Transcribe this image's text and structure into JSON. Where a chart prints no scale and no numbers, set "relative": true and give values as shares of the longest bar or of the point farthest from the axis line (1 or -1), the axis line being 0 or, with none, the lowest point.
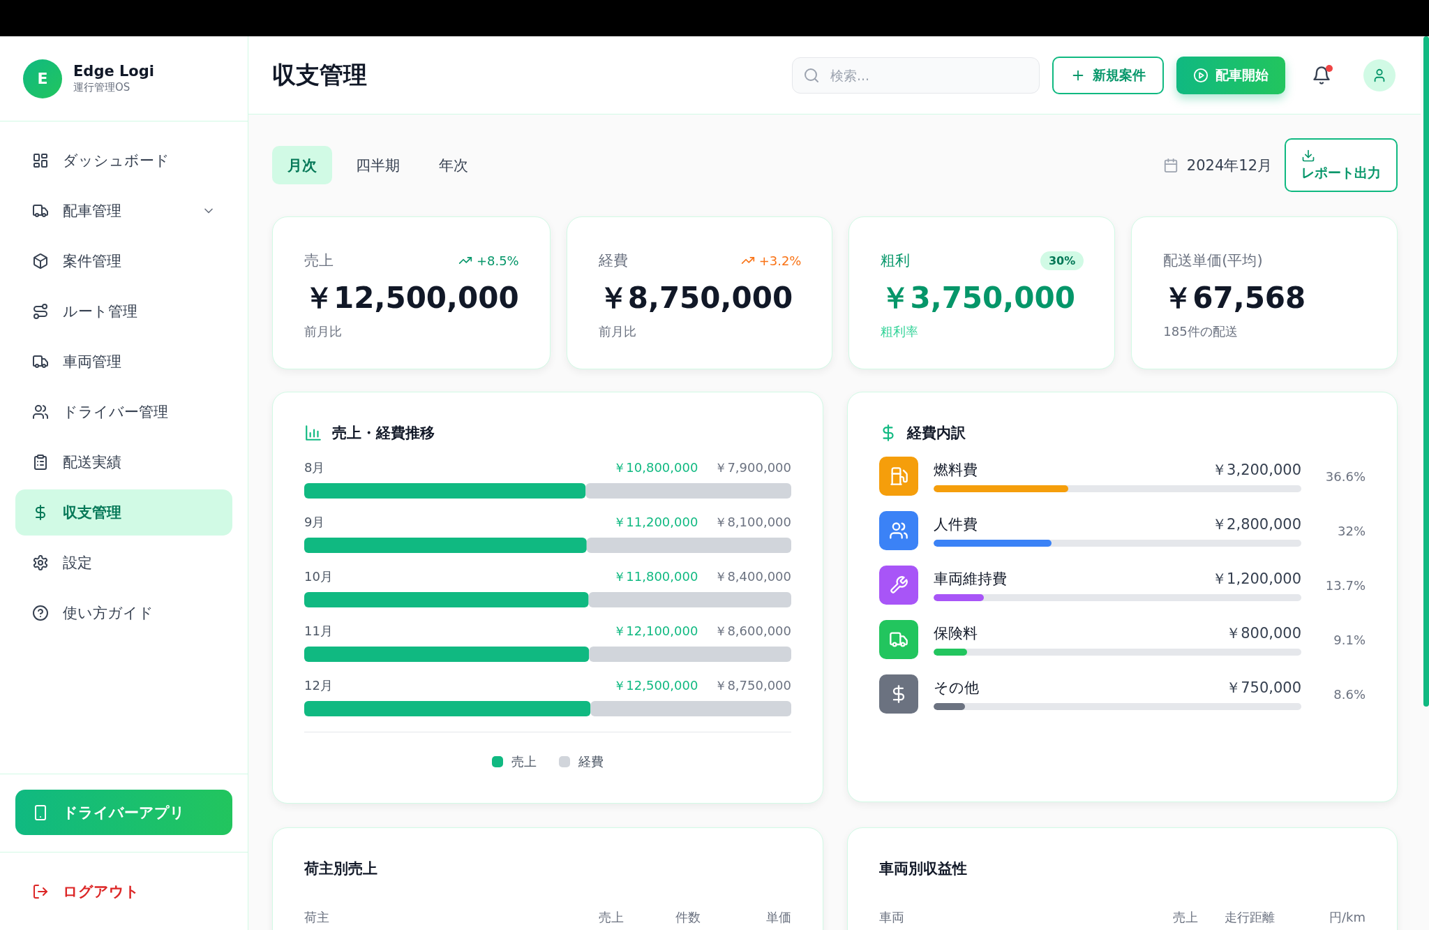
{
  "brand": {
    "logo_letter": "E",
    "name": "Edge Logi",
    "tagline": "運行管理OS"
  },
  "sidebar": {
    "items": [
      {
        "label": "ダッシュボード",
        "selected": false
      },
      {
        "label": "配車管理",
        "selected": false,
        "expanded": false
      },
      {
        "label": "案件管理",
        "selected": false
      },
      {
        "label": "ルート管理",
        "selected": false
      },
      {
        "label": "車両管理",
        "selected": false
      },
      {
        "label": "ドライバー管理",
        "selected": false
      },
      {
        "label": "配送実績",
        "selected": false
      },
      {
        "label": "収支管理",
        "selected": true
      },
      {
        "label": "設定",
        "selected": false
      },
      {
        "label": "使い方ガイド",
        "selected": false
      }
    ],
    "app_button": "ドライバーアプリ",
    "logout": "ログアウト"
  },
  "header": {
    "title": "収支管理",
    "search": {
      "placeholder": "検索..."
    },
    "buttons": [
      {
        "label": "新規案件",
        "kind": "outline"
      },
      {
        "label": "配車開始",
        "kind": "primary"
      }
    ],
    "notifications": {
      "unread": true
    }
  },
  "period_tabs": [
    {
      "label": "月次",
      "selected": true
    },
    {
      "label": "四半期",
      "selected": false
    },
    {
      "label": "年次",
      "selected": false
    }
  ],
  "period": "2024年12月",
  "report_button": "レポート出力",
  "kpis": [
    {
      "label": "売上",
      "value": "￥12,500,000",
      "note": "前月比",
      "badge": {
        "kind": "trend",
        "text": "+8.5%",
        "color": "#059669"
      },
      "accent": false
    },
    {
      "label": "経費",
      "value": "￥8,750,000",
      "note": "前月比",
      "badge": {
        "kind": "trend",
        "text": "+3.2%",
        "color": "#f97316"
      },
      "accent": false
    },
    {
      "label": "粗利",
      "value": "￥3,750,000",
      "note": "粗利率",
      "badge": {
        "kind": "pill",
        "text": "30%",
        "color": "#047857"
      },
      "accent": true
    },
    {
      "label": "配送単価(平均)",
      "value": "￥67,568",
      "note": "185件の配送",
      "accent": false
    }
  ],
  "trend_panel": {
    "title": "売上・経費推移",
    "chart_data": {
      "type": "bar",
      "orientation": "horizontal",
      "stacked": true,
      "relative": true,
      "legend": "bottom",
      "categories": [
        "8月",
        "9月",
        "10月",
        "11月",
        "12月"
      ],
      "series": [
        {
          "name": "売上",
          "color": "#10b981",
          "values": [
            0.578,
            0.58,
            0.584,
            0.585,
            0.588
          ]
        },
        {
          "name": "経費",
          "color": "#d1d5db",
          "values": [
            0.422,
            0.42,
            0.416,
            0.415,
            0.412
          ]
        }
      ],
      "value_labels": [
        [
          "￥10,800,000",
          "￥11,200,000",
          "￥11,800,000",
          "￥12,100,000",
          "￥12,500,000"
        ],
        [
          "￥7,900,000",
          "￥8,100,000",
          "￥8,400,000",
          "￥8,600,000",
          "￥8,750,000"
        ]
      ]
    }
  },
  "expense_panel": {
    "title": "経費内訳",
    "items": [
      {
        "name": "燃料費",
        "amount": "￥3,200,000",
        "share": "36.6%",
        "level": 0.366,
        "color": "#f59e0b"
      },
      {
        "name": "人件費",
        "amount": "￥2,800,000",
        "share": "32%",
        "level": 0.32,
        "color": "#3b82f6"
      },
      {
        "name": "車両維持費",
        "amount": "￥1,200,000",
        "share": "13.7%",
        "level": 0.137,
        "color": "#a855f7"
      },
      {
        "name": "保険料",
        "amount": "￥800,000",
        "share": "9.1%",
        "level": 0.091,
        "color": "#22c55e"
      },
      {
        "name": "その他",
        "amount": "￥750,000",
        "share": "8.6%",
        "level": 0.086,
        "color": "#6b7280"
      }
    ]
  },
  "tables": [
    {
      "title": "荷主別売上",
      "columns": [
        "荷主",
        "売上",
        "件数",
        "単価"
      ]
    },
    {
      "title": "車両別収益性",
      "columns": [
        "車両",
        "売上",
        "走行距離",
        "円/km"
      ]
    }
  ]
}
